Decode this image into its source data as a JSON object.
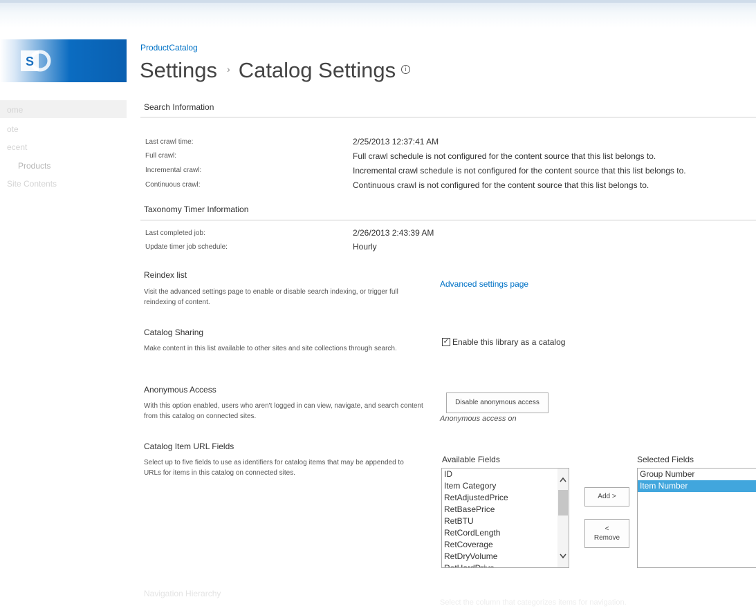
{
  "breadcrumb": {
    "site_link": "ProductCatalog"
  },
  "title": {
    "parent": "Settings",
    "separator": "›",
    "current": "Catalog Settings",
    "info_icon": "i"
  },
  "left_nav": [
    "ome",
    "ote",
    "ecent",
    "Products",
    "Site Contents"
  ],
  "search_info": {
    "heading": "Search Information",
    "rows": [
      {
        "label": "Last crawl time:",
        "value": "2/25/2013 12:37:41 AM"
      },
      {
        "label": "Full crawl:",
        "value": "Full crawl schedule is not configured for the content source that this list belongs to."
      },
      {
        "label": "Incremental crawl:",
        "value": "Incremental crawl schedule is not configured for the content source that this list belongs to."
      },
      {
        "label": "Continuous crawl:",
        "value": "Continuous crawl is not configured for the content source that this list belongs to."
      }
    ]
  },
  "taxonomy": {
    "heading": "Taxonomy Timer Information",
    "rows": [
      {
        "label": "Last completed job:",
        "value": "2/26/2013 2:43:39 AM"
      },
      {
        "label": "Update timer job schedule:",
        "value": "Hourly"
      }
    ]
  },
  "reindex": {
    "title": "Reindex list",
    "description": "Visit the advanced settings page to enable or disable search indexing, or trigger full reindexing of content.",
    "link": "Advanced settings page"
  },
  "catalog_sharing": {
    "title": "Catalog Sharing",
    "description": "Make content in this list available to other sites and site collections through search.",
    "checkbox_label": "Enable this library as a catalog",
    "checked": true,
    "check_mark": "✓"
  },
  "anonymous": {
    "title": "Anonymous Access",
    "description": "With this option enabled, users who aren't logged in can view, navigate, and search content from this catalog on connected sites.",
    "button": "Disable anonymous access",
    "status": "Anonymous access on"
  },
  "url_fields": {
    "title": "Catalog Item URL Fields",
    "description": "Select up to five fields to use as identifiers for catalog items that may be appended to URLs for items in this catalog on connected sites.",
    "available_caption": "Available Fields",
    "available": [
      "ID",
      "Item Category",
      "RetAdjustedPrice",
      "RetBasePrice",
      "RetBTU",
      "RetCordLength",
      "RetCoverage",
      "RetDryVolume",
      "RetHardDrive"
    ],
    "selected_caption": "Selected Fields",
    "selected": [
      "Group Number",
      "Item Number"
    ],
    "add_button": "Add >",
    "remove_button_arrow": "<",
    "remove_button": "Remove"
  },
  "navigation": {
    "title": "Navigation Hierarchy",
    "description": "Select the column that categorizes items for navigation."
  }
}
